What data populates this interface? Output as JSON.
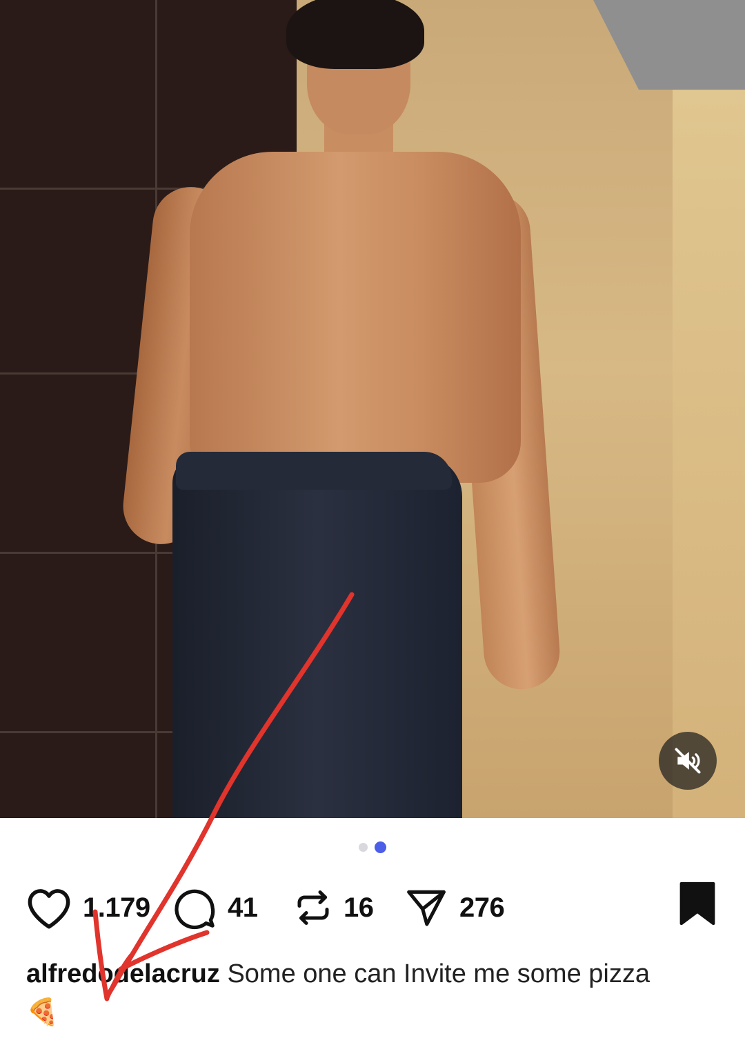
{
  "post": {
    "media": {
      "page_indicator": {
        "count": 2,
        "active_index": 1
      },
      "mute_icon": "speaker-muted-icon"
    },
    "actions": {
      "likes": "1.179",
      "comments": "41",
      "reposts": "16",
      "shares": "276"
    },
    "caption": {
      "username": "alfredodelacruz",
      "text": "Some one can Invite me some pizza 🍕"
    }
  },
  "colors": {
    "annotation_arrow": "#e0342c",
    "active_dot": "#4c5de8",
    "inactive_dot": "#d8d8de"
  }
}
